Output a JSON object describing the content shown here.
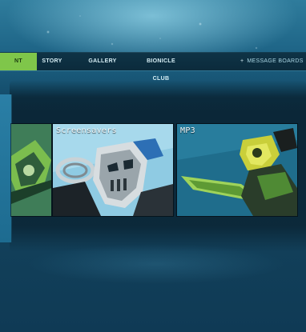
{
  "nav": {
    "items": [
      {
        "label": "NT",
        "active": true
      },
      {
        "label": "STORY",
        "active": false
      },
      {
        "label": "GALLERY",
        "active": false
      },
      {
        "label": "BIONICLE CLUB",
        "active": false
      }
    ],
    "message_boards": {
      "icon": "plus-icon",
      "label": "MESSAGE BOARDS"
    }
  },
  "panels": [
    {
      "title": "",
      "image": "green-robot-figure"
    },
    {
      "title": "Screensavers",
      "image": "silver-masked-robot-figure"
    },
    {
      "title": "MP3",
      "image": "green-yellow-robot-with-blade"
    }
  ],
  "colors": {
    "accent": "#7fc64a",
    "nav_bg": "#0b2b3c",
    "background": "#13425e"
  }
}
